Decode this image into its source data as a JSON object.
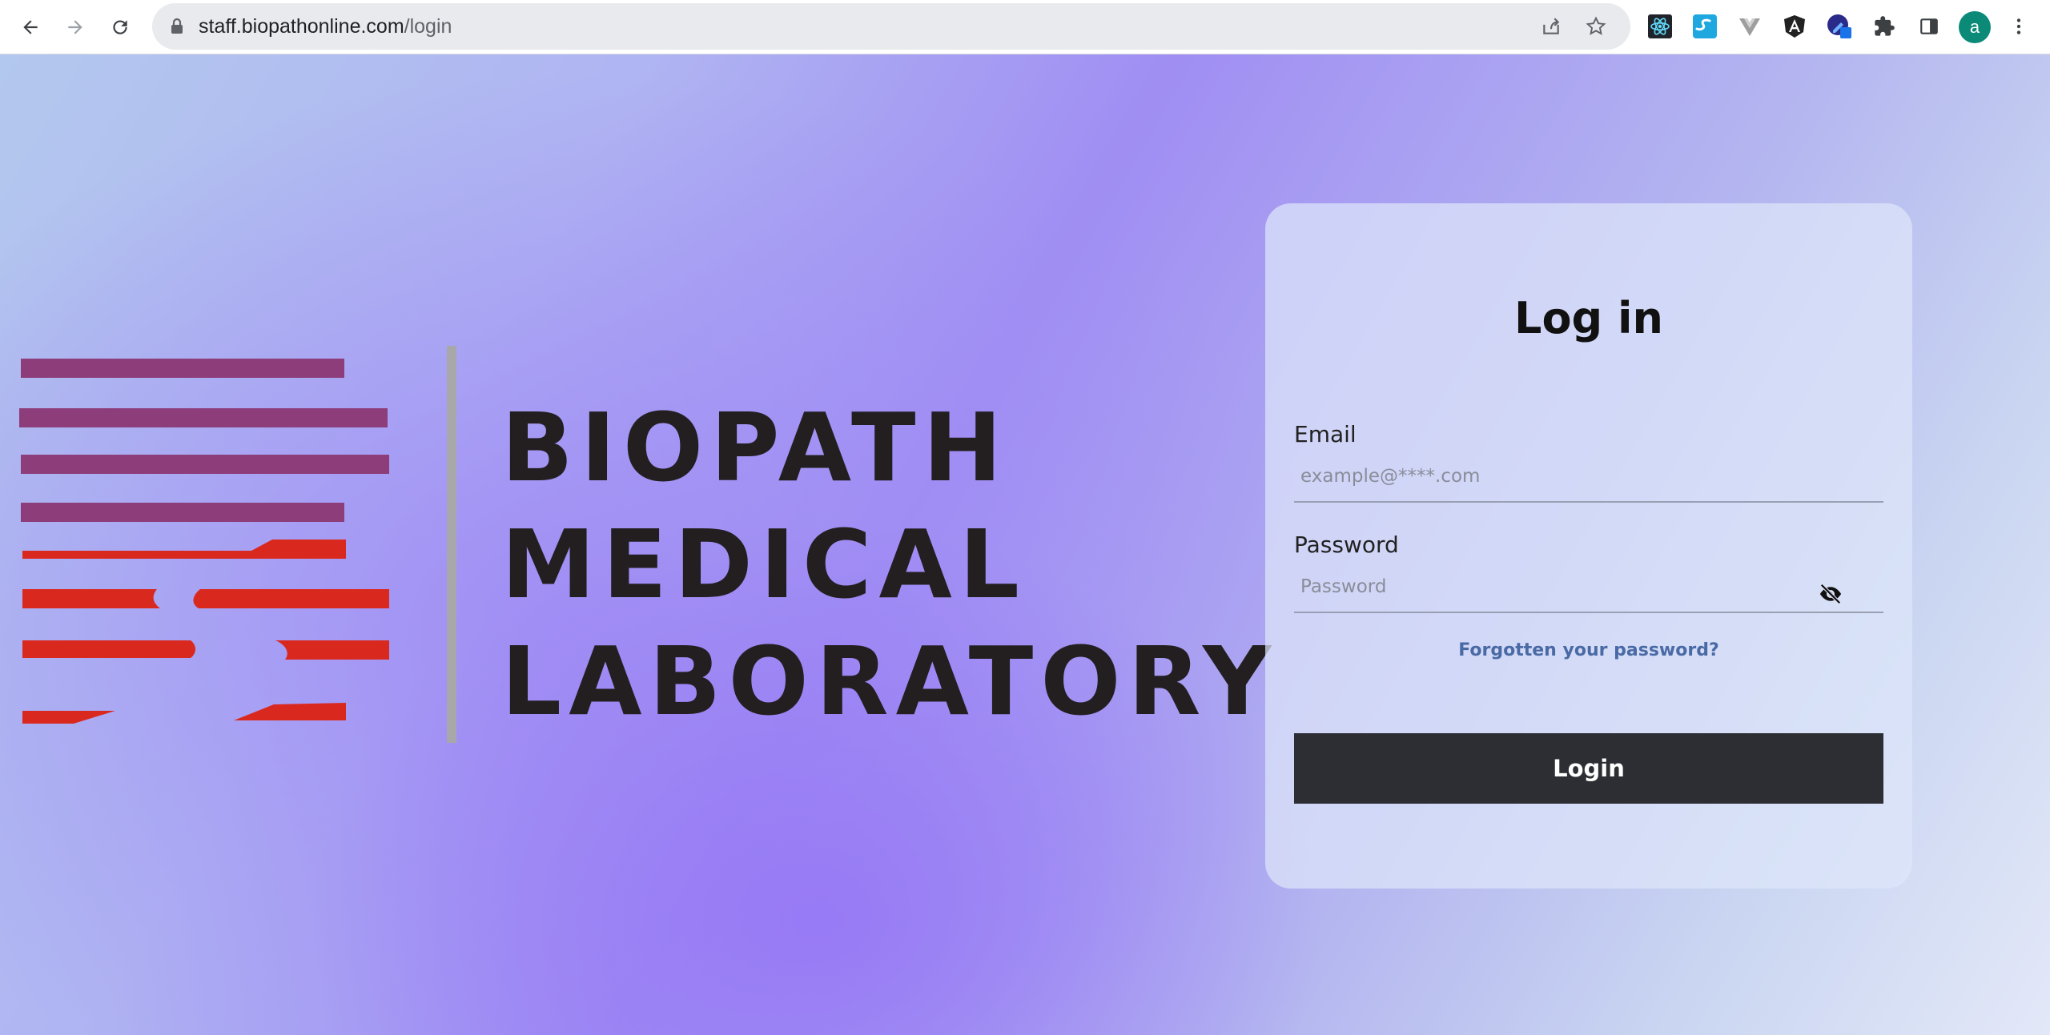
{
  "browser": {
    "url_host": "staff.biopathonline.com",
    "url_path": "/login",
    "profile_initial": "a",
    "icons": {
      "back": "back-arrow-icon",
      "forward": "forward-arrow-icon",
      "reload": "reload-icon",
      "lock": "lock-icon",
      "share": "share-icon",
      "bookmark": "star-icon",
      "extensions": [
        "react-devtools-icon",
        "s-extension-icon",
        "vue-devtools-icon",
        "angular-devtools-icon",
        "colorzilla-icon",
        "puzzle-icon"
      ],
      "side_panel": "side-panel-icon",
      "menu": "kebab-menu-icon"
    }
  },
  "brand": {
    "line1": "BIOPATH",
    "line2": "MEDICAL",
    "line3": "LABORATORY"
  },
  "login": {
    "title": "Log in",
    "email_label": "Email",
    "email_placeholder": "example@****.com",
    "password_label": "Password",
    "password_placeholder": "Password",
    "forgot_link": "Forgotten your password?",
    "submit_label": "Login"
  },
  "colors": {
    "stripe_purple": "#8d3e7a",
    "stripe_red": "#d9291f",
    "button_dark": "#2d2e33",
    "link_blue": "#4a6aa5"
  }
}
